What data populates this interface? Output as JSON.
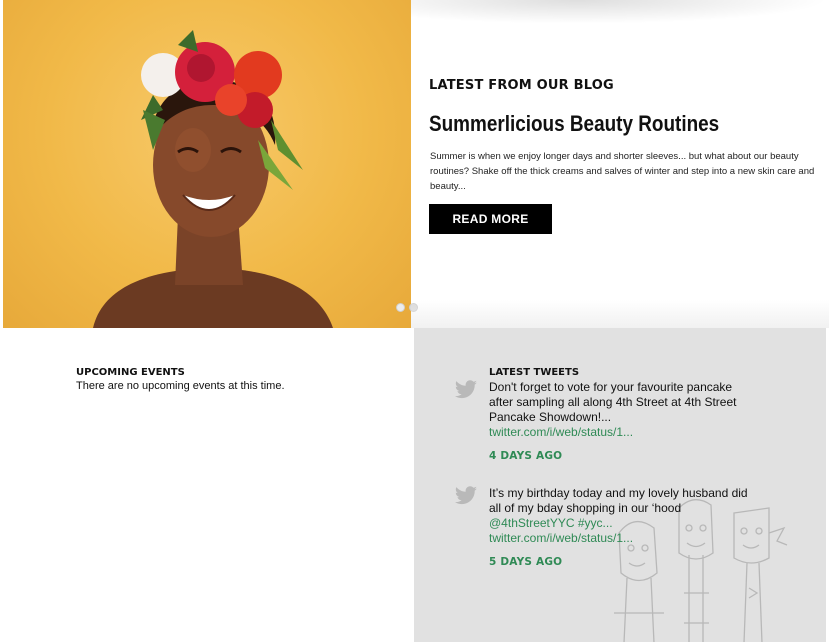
{
  "blog": {
    "kicker": "LATEST FROM OUR BLOG",
    "title": "Summerlicious Beauty Routines",
    "excerpt": "Summer is when we enjoy longer days and shorter sleeves... but what about our beauty routines? Shake off the thick creams and salves of winter and step into a new skin care and beauty...",
    "read_more_label": "READ MORE"
  },
  "carousel": {
    "slides": 3,
    "active_index": 0
  },
  "events": {
    "heading": "UPCOMING EVENTS",
    "empty_text": "There are no upcoming events at this time."
  },
  "tweets": {
    "heading": "LATEST TWEETS",
    "items": [
      {
        "text": "Don't forget to vote for your favourite pancake after sampling all along 4th Street at 4th Street Pancake Showdown!...",
        "mention": "",
        "link": "twitter.com/i/web/status/1...",
        "ago": "4 DAYS AGO"
      },
      {
        "text": "It’s my birthday today and my lovely husband did all of my bday shopping in our ‘hood",
        "mention": "@4thStreetYYC #yyc...",
        "link": "twitter.com/i/web/status/1...",
        "ago": "5 DAYS AGO"
      }
    ]
  },
  "colors": {
    "accent_green": "#2f8a55",
    "panel_gray": "#e1e1e1",
    "button_black": "#000000",
    "hero_yellow": "#f1b948"
  },
  "icons": [
    "twitter-bird-icon"
  ]
}
